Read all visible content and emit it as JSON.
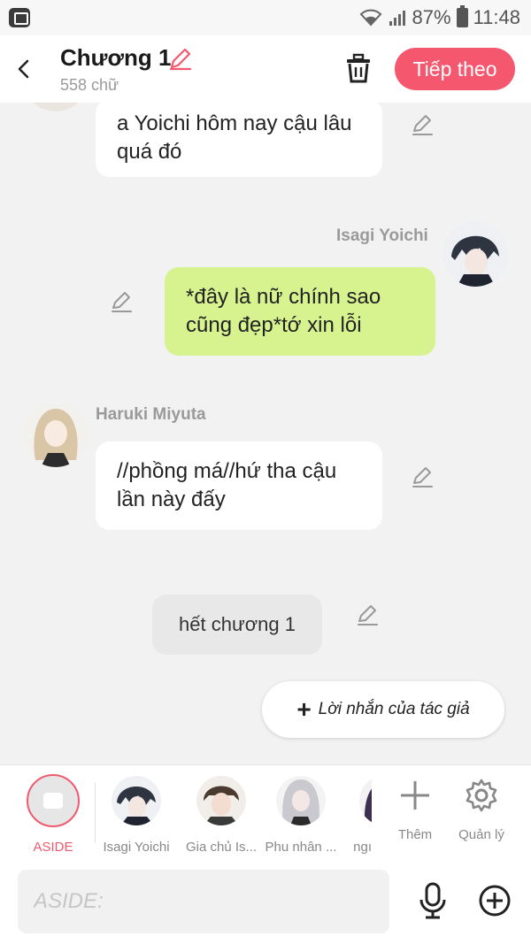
{
  "status_bar": {
    "battery": "87%",
    "time": "11:48",
    "icons": [
      "app-icon",
      "wifi-icon",
      "signal-icon",
      "battery-icon"
    ]
  },
  "header": {
    "title": "Chương 1",
    "word_count": "558 chữ",
    "next_label": "Tiếp theo",
    "accent_color": "#f4576e"
  },
  "messages": [
    {
      "speaker": "",
      "side": "left",
      "style": "white",
      "text": "a Yoichi hôm nay cậu lâu quá đó"
    },
    {
      "speaker": "Isagi Yoichi",
      "side": "right",
      "style": "green",
      "text": "*đây là nữ chính sao cũng đẹp*tớ xin lỗi"
    },
    {
      "speaker": "Haruki Miyuta",
      "side": "left",
      "style": "white",
      "text": "//phồng má//hứ tha cậu lần này đấy"
    },
    {
      "speaker": "",
      "side": "center",
      "style": "grey",
      "text": "hết chương 1"
    }
  ],
  "author_note_button": "Lời nhắn của tác giả",
  "character_bar": {
    "aside_label": "ASIDE",
    "characters": [
      "Isagi Yoichi",
      "Gia chủ Is...",
      "Phu nhân ...",
      "ngı"
    ],
    "more_label": "Thêm",
    "manage_label": "Quản lý"
  },
  "composer": {
    "placeholder": "ASIDE:",
    "value": ""
  }
}
